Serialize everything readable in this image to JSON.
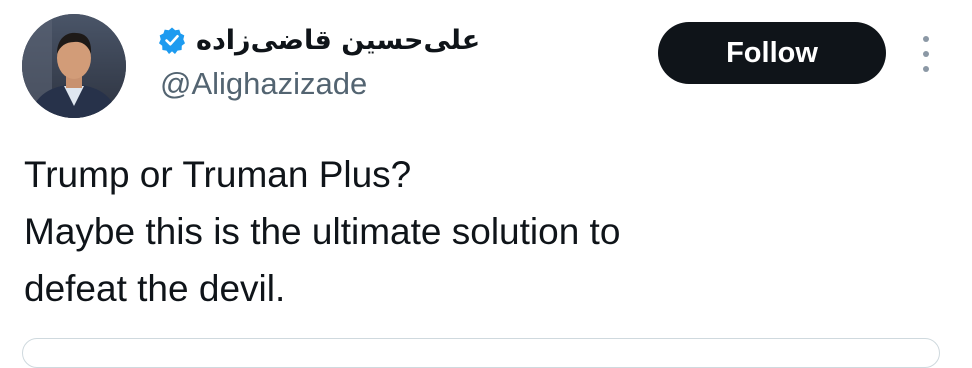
{
  "author": {
    "display_name": "علی‌حسین قاضی‌زاده",
    "handle": "@Alighazizade",
    "verified": true,
    "verified_color": "#1d9bf0"
  },
  "actions": {
    "follow_label": "Follow"
  },
  "icons": {
    "verified": "verified-badge-icon",
    "more": "more-options-icon"
  },
  "tweet": {
    "lines": [
      "Trump or Truman Plus?",
      "Maybe this is the ultimate solution to",
      "defeat the devil."
    ]
  }
}
